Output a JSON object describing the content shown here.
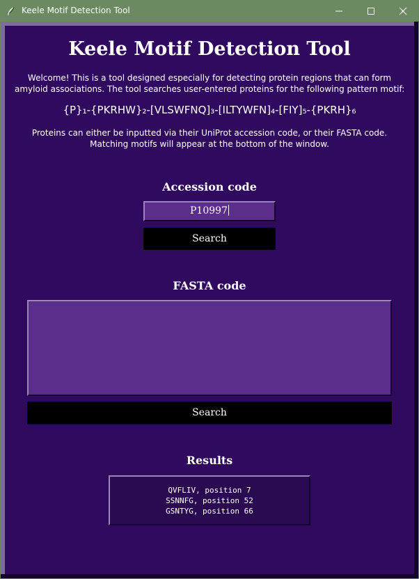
{
  "window": {
    "title": "Keele Motif Detection Tool",
    "icons": [
      "feather-icon",
      "minimize-icon",
      "maximize-icon",
      "close-icon"
    ],
    "colors": {
      "titlebar": "#6b8a62",
      "background": "#2f0a5e",
      "input": "#5a2e8a",
      "button": "#000000"
    }
  },
  "main": {
    "title": "Keele Motif Detection Tool",
    "intro_line1": "Welcome! This is a tool designed especially for detecting protein regions that can form",
    "intro_line2": "amyloid associations. The tool searches user-entered proteins for the following pattern motif:",
    "motif": "{P}₁-{PKRHW}₂-[VLSWFNQ]₃-[ILTYWFN]₄-[FIY]₅-{PKRH}₆",
    "info_line1": "Proteins can either be inputted via their UniProt accession code, or their FASTA code.",
    "info_line2": "Matching motifs will appear at the bottom of the window."
  },
  "accession": {
    "label": "Accession code",
    "value": "P10997",
    "search_label": "Search"
  },
  "fasta": {
    "label": "FASTA code",
    "value": "",
    "search_label": "Search"
  },
  "results": {
    "label": "Results",
    "lines": [
      "QVFLIV, position 7",
      "SSNNFG, position 52",
      "GSNTYG, position 66"
    ]
  }
}
